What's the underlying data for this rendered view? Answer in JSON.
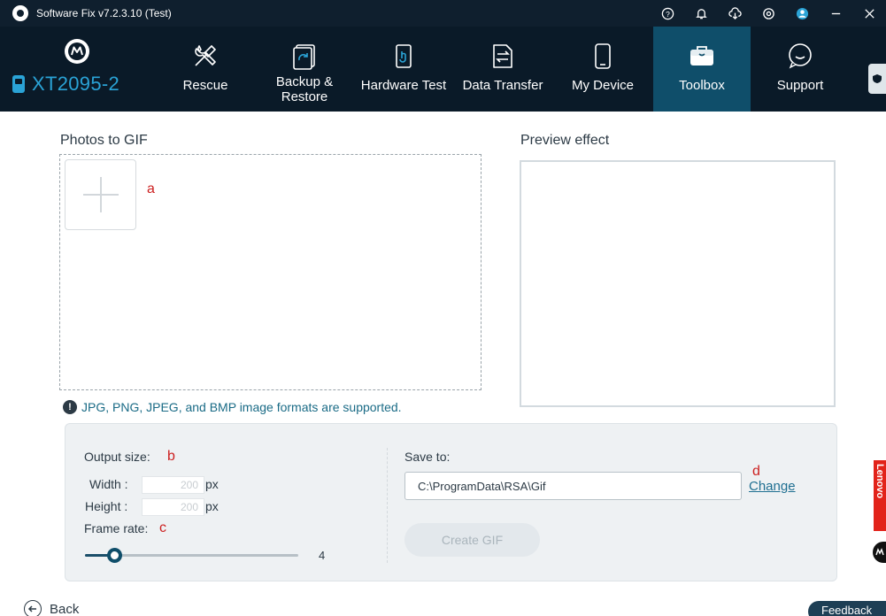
{
  "titlebar": {
    "title": "Software Fix v7.2.3.10 (Test)",
    "icons": [
      "help-icon",
      "bell-icon",
      "download-icon",
      "settings-icon",
      "account-icon",
      "minimize-icon",
      "close-icon"
    ]
  },
  "device": {
    "model": "XT2095-2",
    "brand_icon": "motorola-logo"
  },
  "nav": {
    "items": [
      {
        "label": "Rescue",
        "icon": "tools-icon"
      },
      {
        "label": "Backup &\nRestore",
        "icon": "backup-icon"
      },
      {
        "label": "Hardware Test",
        "icon": "hardware-test-icon"
      },
      {
        "label": "Data Transfer",
        "icon": "data-transfer-icon"
      },
      {
        "label": "My Device",
        "icon": "phone-icon"
      },
      {
        "label": "Toolbox",
        "icon": "toolbox-icon"
      },
      {
        "label": "Support",
        "icon": "chat-icon"
      }
    ],
    "active": "Toolbox"
  },
  "main": {
    "photos_title": "Photos to GIF",
    "preview_title": "Preview effect",
    "format_note": "JPG, PNG, JPEG, and BMP image formats are supported.",
    "markers": {
      "a": "a",
      "b": "b",
      "c": "c",
      "d": "d"
    }
  },
  "settings": {
    "output_size_label": "Output size:",
    "width_label": "Width :",
    "width_value": "200",
    "height_label": "Height :",
    "height_value": "200",
    "unit": "px",
    "frame_rate_label": "Frame rate:",
    "frame_rate_value": "4",
    "frame_rate_fraction": 0.14,
    "save_to_label": "Save to:",
    "save_path": "C:\\ProgramData\\RSA\\Gif",
    "change_label": "Change",
    "create_label": "Create GIF"
  },
  "footer": {
    "back_label": "Back",
    "feedback_label": "Feedback"
  },
  "side": {
    "lenovo_label": "Lenovo"
  },
  "colors": {
    "header_bg": "#0a1a28",
    "active_tab": "#0f4e6a",
    "accent": "#2aa3d6",
    "link": "#1f6f91",
    "marker": "#cc1f1f"
  }
}
